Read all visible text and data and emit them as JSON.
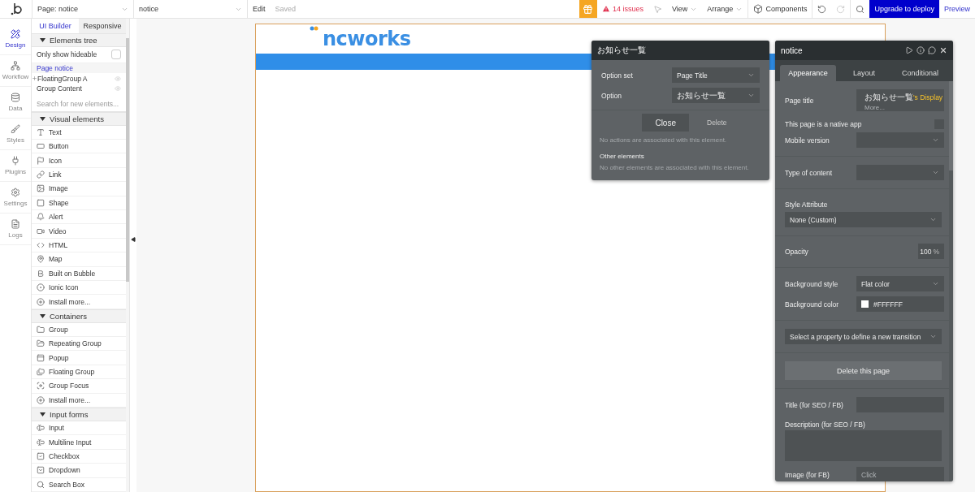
{
  "top_bar": {
    "page_select": "Page: notice",
    "element_select": "notice",
    "edit": "Edit",
    "status": "Saved",
    "issues": "14 issues",
    "menus": [
      {
        "label": "View"
      },
      {
        "label": "Arrange"
      }
    ],
    "components": "Components",
    "upgrade": "Upgrade to deploy",
    "preview": "Preview"
  },
  "sidebar": {
    "items": [
      {
        "label": "Design",
        "selected": true
      },
      {
        "label": "Workflow",
        "selected": false
      },
      {
        "label": "Data",
        "selected": false
      },
      {
        "label": "Styles",
        "selected": false
      },
      {
        "label": "Plugins",
        "selected": false
      },
      {
        "label": "Settings",
        "selected": false
      },
      {
        "label": "Logs",
        "selected": false
      }
    ]
  },
  "palette": {
    "tabs": [
      {
        "label": "UI Builder",
        "selected": true
      },
      {
        "label": "Responsive",
        "selected": false
      }
    ],
    "elements_tree": {
      "title": "Elements tree",
      "expanded": true,
      "hideable_label": "Only show hideable",
      "hideable_checked": false,
      "items": [
        {
          "label": "Page notice",
          "selected": true,
          "expandable": false,
          "eye": false
        },
        {
          "label": "FloatingGroup A",
          "selected": false,
          "expandable": true,
          "eye": true
        },
        {
          "label": "Group Content",
          "selected": false,
          "expandable": false,
          "eye": true
        }
      ]
    },
    "search": {
      "placeholder": "Search for new elements..."
    },
    "sections": [
      {
        "title": "Visual elements",
        "expanded": true,
        "items": [
          {
            "label": "Text"
          },
          {
            "label": "Button"
          },
          {
            "label": "Icon"
          },
          {
            "label": "Link"
          },
          {
            "label": "Image"
          },
          {
            "label": "Shape"
          },
          {
            "label": "Alert"
          },
          {
            "label": "Video"
          },
          {
            "label": "HTML"
          },
          {
            "label": "Map"
          },
          {
            "label": "Built on Bubble"
          },
          {
            "label": "Ionic Icon"
          },
          {
            "label": "Install more..."
          }
        ]
      },
      {
        "title": "Containers",
        "expanded": true,
        "items": [
          {
            "label": "Group"
          },
          {
            "label": "Repeating Group"
          },
          {
            "label": "Popup"
          },
          {
            "label": "Floating Group"
          },
          {
            "label": "Group Focus"
          },
          {
            "label": "Install more..."
          }
        ]
      },
      {
        "title": "Input forms",
        "expanded": true,
        "items": [
          {
            "label": "Input"
          },
          {
            "label": "Multiline Input"
          },
          {
            "label": "Checkbox"
          },
          {
            "label": "Dropdown"
          },
          {
            "label": "Search Box"
          }
        ]
      }
    ]
  },
  "canvas": {
    "logo": "ncworks"
  },
  "popup": {
    "title": "お知らせ一覧",
    "fields": [
      {
        "label": "Option set",
        "value": "Page Title"
      },
      {
        "label": "Option",
        "value": "お知らせ一覧"
      }
    ],
    "close": "Close",
    "delete": "Delete",
    "actions_note": "No actions are associated with this element.",
    "other_title": "Other elements",
    "other_note": "No other elements are associated with this element."
  },
  "inspector": {
    "title": "notice",
    "tabs": [
      {
        "label": "Appearance",
        "selected": true
      },
      {
        "label": "Layout",
        "selected": false
      },
      {
        "label": "Conditional",
        "selected": false
      }
    ],
    "page_title": {
      "label": "Page title",
      "value": "お知らせ一覧",
      "suffix": "'s Display",
      "hint": "More..."
    },
    "native_app": {
      "label": "This page is a native app",
      "checked": false
    },
    "mobile_version": {
      "label": "Mobile version"
    },
    "content_type": {
      "label": "Type of content"
    },
    "style": {
      "label": "Style Attribute",
      "value": "None (Custom)"
    },
    "opacity": {
      "label": "Opacity",
      "value": "100",
      "unit": "%"
    },
    "background_style": {
      "label": "Background style",
      "value": "Flat color"
    },
    "background_color": {
      "label": "Background color",
      "value": "#FFFFFF",
      "color": "#ffffff"
    },
    "transition": {
      "placeholder": "Select a property to define a new transition"
    },
    "delete_page": "Delete this page",
    "seo_title": {
      "label": "Title (for SEO / FB)"
    },
    "seo_description": {
      "label": "Description (for SEO / FB)"
    },
    "fb_image": {
      "label": "Image (for FB)",
      "placeholder": "Click"
    }
  }
}
